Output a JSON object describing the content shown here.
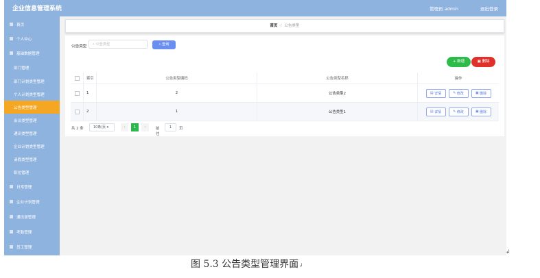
{
  "app": {
    "title": "企业信息管理系统",
    "user": "管理员 admin",
    "logout": "退出登录"
  },
  "sidebar": {
    "items": [
      {
        "label": "首页",
        "sub": false
      },
      {
        "label": "个人中心",
        "sub": false
      },
      {
        "label": "基础数据管理",
        "sub": false
      },
      {
        "label": "部门管理",
        "sub": true
      },
      {
        "label": "部门计划类型管理",
        "sub": true
      },
      {
        "label": "个人计划类型管理",
        "sub": true
      },
      {
        "label": "公告类型管理",
        "sub": true,
        "active": true
      },
      {
        "label": "会议类型管理",
        "sub": true
      },
      {
        "label": "通讯类型管理",
        "sub": true
      },
      {
        "label": "企业计划类型管理",
        "sub": true
      },
      {
        "label": "请假类型管理",
        "sub": true
      },
      {
        "label": "职位管理",
        "sub": true
      },
      {
        "label": "日常管理",
        "sub": false
      },
      {
        "label": "企业计划管理",
        "sub": false
      },
      {
        "label": "通讯录管理",
        "sub": false
      },
      {
        "label": "考勤管理",
        "sub": false
      },
      {
        "label": "员工管理",
        "sub": false
      }
    ]
  },
  "breadcrumb": {
    "home": "首页",
    "sep": "/",
    "current": "公告类型"
  },
  "search": {
    "label": "公告类型",
    "placeholder": "公告类型",
    "button": "查询"
  },
  "actions": {
    "add": "新增",
    "delete": "删除"
  },
  "table": {
    "headers": {
      "index": "索引",
      "code": "公告类型编码",
      "name": "公告类型名称",
      "op": "操作"
    },
    "rows": [
      {
        "index": "1",
        "code": "2",
        "name": "公告类型2"
      },
      {
        "index": "2",
        "code": "1",
        "name": "公告类型1"
      }
    ],
    "row_buttons": {
      "detail": "详情",
      "edit": "修改",
      "delete": "删除"
    }
  },
  "pagination": {
    "total": "共 2 条",
    "page_size": "10条/页",
    "prev": "‹",
    "current_page": "1",
    "next": "›",
    "goto_prefix": "前往",
    "goto_value": "1",
    "goto_suffix": "页"
  },
  "caption": {
    "text": "图 5.3 公告类型管理界面",
    "mark": "↲"
  },
  "colors": {
    "sidebar_bg": "#8fb3df",
    "active_item": "#f5a623",
    "primary": "#6b8ff0",
    "success": "#2fbb4a",
    "danger": "#e0302a"
  }
}
